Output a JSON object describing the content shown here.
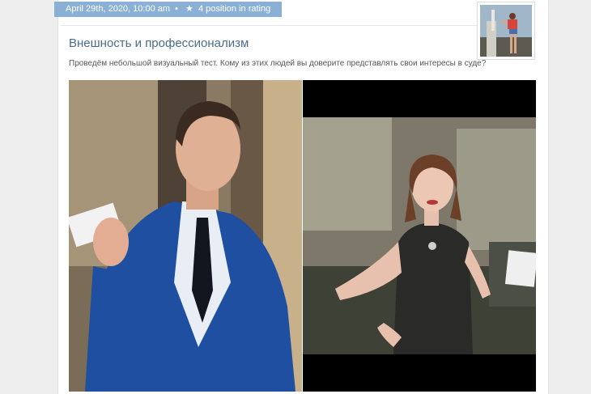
{
  "post": {
    "meta": {
      "date": "April 29th, 2020, 10:00 am",
      "separator": "•",
      "star_icon": "star-icon",
      "rating": "4 position in rating"
    },
    "title": "Внешность и профессионализм",
    "text": "Проведём небольшой визуальный тест. Кому из этих людей вы доверите представлять свои интересы в суде?"
  },
  "author": {
    "avatar": "author-avatar-photo"
  },
  "images": [
    {
      "name": "photo-man-in-blue-suit"
    },
    {
      "name": "photo-woman-in-black-dress"
    }
  ],
  "colors": {
    "badge": "#8ab0d6",
    "title": "#4a6c8c",
    "text": "#555555"
  }
}
